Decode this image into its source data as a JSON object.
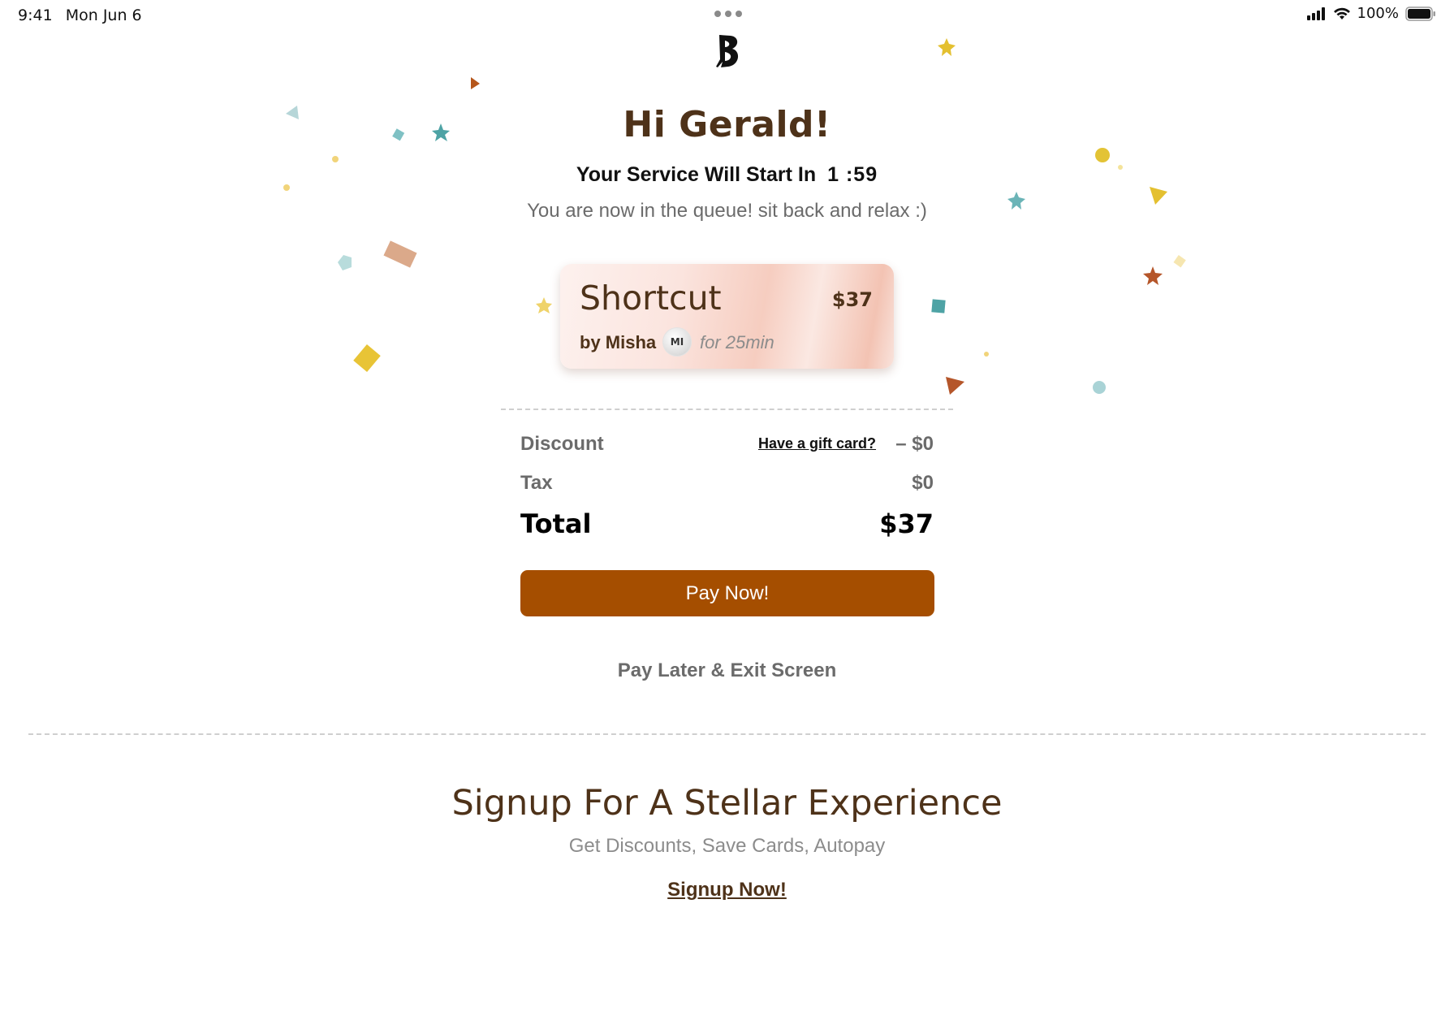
{
  "status_bar": {
    "time": "9:41",
    "date": "Mon Jun 6",
    "battery": "100%"
  },
  "greeting": "Hi Gerald!",
  "service_start": {
    "label": "Your Service Will Start In",
    "timer": "1 :59"
  },
  "queue_message": "You are now in the queue! sit back and relax :)",
  "service_card": {
    "title": "Shortcut",
    "price": "$37",
    "by": "by Misha",
    "avatar_initials": "MI",
    "duration": "for 25min"
  },
  "summary": {
    "discount_label": "Discount",
    "gift_card_link": "Have a gift card?",
    "discount_value": "– $0",
    "tax_label": "Tax",
    "tax_value": "$0",
    "total_label": "Total",
    "total_value": "$37"
  },
  "actions": {
    "pay_now": "Pay Now!",
    "pay_later": "Pay Later & Exit Screen"
  },
  "signup": {
    "title": "Signup For A Stellar Experience",
    "subtitle": "Get Discounts, Save Cards, Autopay",
    "link": "Signup Now!"
  },
  "colors": {
    "brand_brown": "#4e3219",
    "button_orange": "#a54e00",
    "muted_gray": "#6b6b6b"
  },
  "icons": {
    "logo": "b-logo-icon",
    "signal": "cellular-signal-icon",
    "wifi": "wifi-icon",
    "battery": "battery-icon",
    "multitask": "multitask-dots-icon"
  }
}
